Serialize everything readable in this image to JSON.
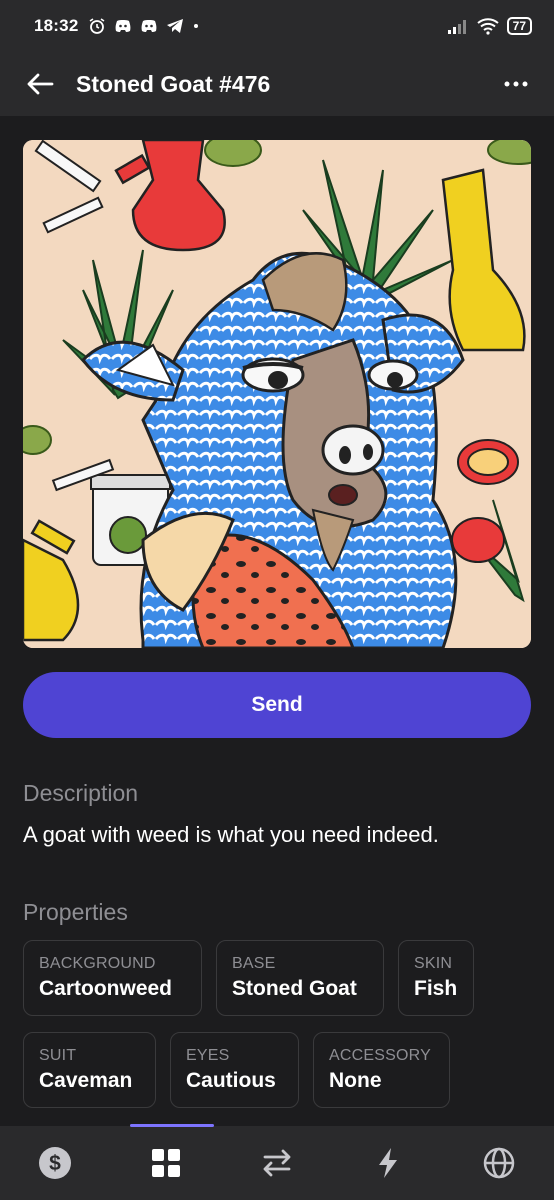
{
  "status_bar": {
    "time": "18:32",
    "battery": "77"
  },
  "header": {
    "title": "Stoned Goat #476"
  },
  "nft": {
    "image_icon": "stoned-goat-artwork"
  },
  "actions": {
    "send_label": "Send"
  },
  "description": {
    "heading": "Description",
    "text": "A goat with weed is what you need indeed."
  },
  "properties": {
    "heading": "Properties",
    "items": [
      {
        "label": "BACKGROUND",
        "value": "Cartoonweed"
      },
      {
        "label": "BASE",
        "value": "Stoned Goat"
      },
      {
        "label": "SKIN",
        "value": "Fish"
      },
      {
        "label": "SUIT",
        "value": "Caveman"
      },
      {
        "label": "EYES",
        "value": "Cautious"
      },
      {
        "label": "ACCESSORY",
        "value": "None"
      }
    ]
  },
  "bottom_nav": {
    "items": [
      "dollar-icon",
      "grid-icon",
      "swap-icon",
      "bolt-icon",
      "globe-icon"
    ],
    "active": "grid-icon"
  },
  "colors": {
    "accent": "#4f44d3",
    "background": "#1c1c1e",
    "surface": "#2a2a2c",
    "muted_text": "#8e8e93"
  }
}
